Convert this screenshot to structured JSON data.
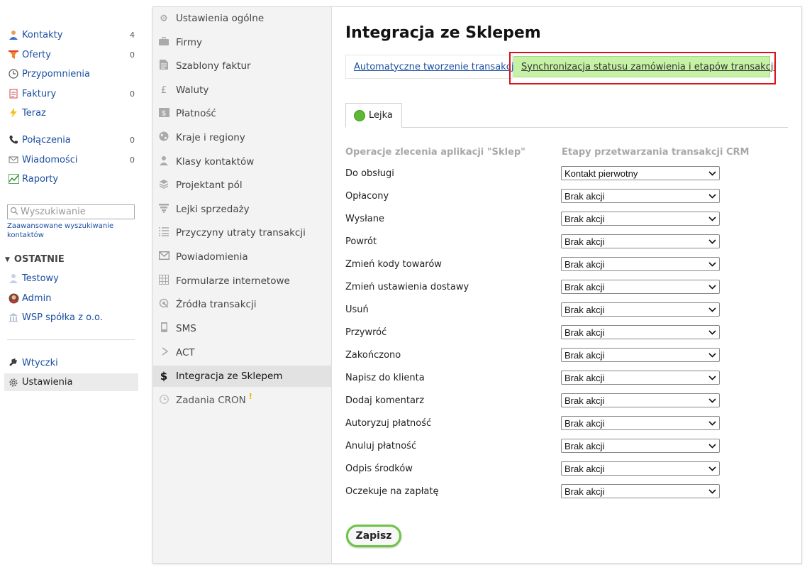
{
  "leftnav": {
    "items": [
      {
        "label": "Kontakty",
        "count": "4",
        "icon": "contacts-icon"
      },
      {
        "label": "Oferty",
        "count": "0",
        "icon": "offers-funnel-icon"
      },
      {
        "label": "Przypomnienia",
        "icon": "clock-icon"
      },
      {
        "label": "Faktury",
        "count": "0",
        "icon": "invoice-icon"
      },
      {
        "label": "Teraz",
        "icon": "lightning-icon"
      },
      {
        "label": "Połączenia",
        "count": "0",
        "icon": "phone-icon"
      },
      {
        "label": "Wiadomości",
        "count": "0",
        "icon": "envelope-icon"
      },
      {
        "label": "Raporty",
        "icon": "chart-icon"
      }
    ],
    "search_placeholder": "Wyszukiwanie",
    "advanced_search": "Zaawansowane wyszukiwanie kontaktów",
    "recent_header": "OSTATNIE",
    "recent": [
      {
        "label": "Testowy",
        "icon": "person-icon"
      },
      {
        "label": "Admin",
        "icon": "avatar-icon"
      },
      {
        "label": "WSP spółka z o.o.",
        "icon": "company-icon"
      }
    ],
    "bottom": [
      {
        "label": "Wtyczki",
        "icon": "plug-icon"
      },
      {
        "label": "Ustawienia",
        "icon": "gear-icon"
      }
    ]
  },
  "settings_menu": [
    {
      "label": "Ustawienia ogólne",
      "icon": "gear-icon"
    },
    {
      "label": "Firmy",
      "icon": "briefcase-icon"
    },
    {
      "label": "Szablony faktur",
      "icon": "document-icon"
    },
    {
      "label": "Waluty",
      "icon": "pound-icon"
    },
    {
      "label": "Płatność",
      "icon": "dollar-box-icon"
    },
    {
      "label": "Kraje i regiony",
      "icon": "globe-icon"
    },
    {
      "label": "Klasy kontaktów",
      "icon": "person-icon"
    },
    {
      "label": "Projektant pól",
      "icon": "layers-icon"
    },
    {
      "label": "Lejki sprzedaży",
      "icon": "funnel-icon"
    },
    {
      "label": "Przyczyny utraty transakcji",
      "icon": "list-icon"
    },
    {
      "label": "Powiadomienia",
      "icon": "mail-icon"
    },
    {
      "label": "Formularze internetowe",
      "icon": "grid-icon"
    },
    {
      "label": "Źródła transakcji",
      "icon": "source-icon"
    },
    {
      "label": "SMS",
      "icon": "mobile-icon"
    },
    {
      "label": "ACT",
      "icon": "act-icon"
    },
    {
      "label": "Integracja ze Sklepem",
      "icon": "dollar-icon"
    },
    {
      "label": "Zadania CRON",
      "icon": "clock-icon",
      "warning": "!"
    }
  ],
  "content": {
    "title": "Integracja ze Sklepem",
    "subtabs": {
      "auto": "Automatyczne tworzenie transakcji",
      "sync": "Synchronizacja statusu zamówienia i etapów transakcji"
    },
    "funnel_tab": "Lejka",
    "col_left": "Operacje zlecenia aplikacji \"Sklep\"",
    "col_right": "Etapy przetwarzania transakcji CRM",
    "rows": [
      {
        "op": "Do obsługi",
        "stage": "Kontakt pierwotny"
      },
      {
        "op": "Opłacony",
        "stage": "Brak akcji"
      },
      {
        "op": "Wysłane",
        "stage": "Brak akcji"
      },
      {
        "op": "Powrót",
        "stage": "Brak akcji"
      },
      {
        "op": "Zmień kody towarów",
        "stage": "Brak akcji"
      },
      {
        "op": "Zmień ustawienia dostawy",
        "stage": "Brak akcji"
      },
      {
        "op": "Usuń",
        "stage": "Brak akcji"
      },
      {
        "op": "Przywróć",
        "stage": "Brak akcji"
      },
      {
        "op": "Zakończono",
        "stage": "Brak akcji"
      },
      {
        "op": "Napisz do klienta",
        "stage": "Brak akcji"
      },
      {
        "op": "Dodaj komentarz",
        "stage": "Brak akcji"
      },
      {
        "op": "Autoryzuj płatność",
        "stage": "Brak akcji"
      },
      {
        "op": "Anuluj płatność",
        "stage": "Brak akcji"
      },
      {
        "op": "Odpis środków",
        "stage": "Brak akcji"
      },
      {
        "op": "Oczekuje na zapłatę",
        "stage": "Brak akcji"
      }
    ],
    "save": "Zapisz"
  },
  "colors": {
    "link": "#1a4fa0",
    "active_tab_bg": "#c6f2a6",
    "highlight_border": "#d8141a",
    "funnel_dot": "#5db836",
    "save_border": "#6dc442"
  }
}
